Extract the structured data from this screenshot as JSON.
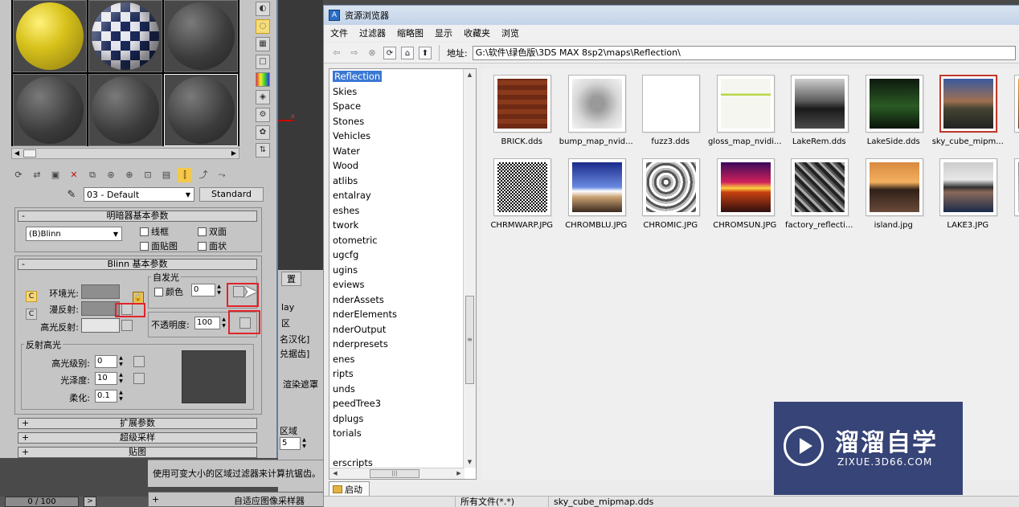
{
  "material_editor": {
    "material_name": "03 - Default",
    "material_type_button": "Standard",
    "shader_rollout": {
      "title": "明暗器基本参数",
      "shader": "(B)Blinn",
      "options": [
        "线框",
        "双面",
        "面贴图",
        "面状"
      ]
    },
    "blinn_rollout": {
      "title": "Blinn 基本参数",
      "ambient_label": "环境光:",
      "diffuse_label": "漫反射:",
      "specular_label": "高光反射:",
      "self_illum_group": "自发光",
      "color_checkbox": "颜色",
      "self_illum_value": "0",
      "opacity_label": "不透明度:",
      "opacity_value": "100",
      "specular_group": "反射高光",
      "specular_level_label": "高光级别:",
      "specular_level_value": "0",
      "glossiness_label": "光泽度:",
      "glossiness_value": "10",
      "soften_label": "柔化:",
      "soften_value": "0.1"
    },
    "collapsed_rollouts": [
      "扩展参数",
      "超级采样",
      "贴图"
    ]
  },
  "render_panel": {
    "tab_fragment": "置",
    "lines": [
      "lay",
      "区",
      "名汉化]",
      "兑据齿]",
      "渲染遮罩",
      "区域"
    ],
    "filter_value": "5",
    "status_text": "使用可变大小的区域过滤器来计算抗锯齿。",
    "bottom_rollout": "自适应图像采样器",
    "time_slider": "0 / 100",
    "time_next": ">"
  },
  "asset_browser": {
    "title": "资源浏览器",
    "menu": [
      "文件",
      "过滤器",
      "缩略图",
      "显示",
      "收藏夹",
      "浏览"
    ],
    "address_label": "地址:",
    "address_value": "G:\\软件\\绿色版\\3DS MAX 8sp2\\maps\\Reflection\\",
    "tree_items": [
      "Reflection",
      "Skies",
      "Space",
      "Stones",
      "Vehicles",
      "Water",
      "Wood",
      "atlibs",
      "entalray",
      "eshes",
      "twork",
      "otometric",
      "ugcfg",
      "ugins",
      "eviews",
      "nderAssets",
      "nderElements",
      "nderOutput",
      "nderpresets",
      "enes",
      "ripts",
      "unds",
      "peedTree3",
      "dplugs",
      "torials",
      "",
      "erscripts"
    ],
    "selected_tree_item": "Reflection",
    "thumbnails": [
      {
        "name": "BRICK.dds",
        "kind": "brick"
      },
      {
        "name": "bump_map_nvid...",
        "kind": "nvidia-gray"
      },
      {
        "name": "fuzz3.dds",
        "kind": "file-icon"
      },
      {
        "name": "gloss_map_nvidi...",
        "kind": "nvidia-green"
      },
      {
        "name": "LakeRem.dds",
        "kind": "lake-dark"
      },
      {
        "name": "LakeSide.dds",
        "kind": "lake-green"
      },
      {
        "name": "sky_cube_mipm...",
        "kind": "sky-cube",
        "selected": true
      },
      {
        "name": "sunc",
        "kind": "sun-partial"
      },
      {
        "name": "CHRMWARP.JPG",
        "kind": "noise"
      },
      {
        "name": "CHROMBLU.JPG",
        "kind": "chrome-blue"
      },
      {
        "name": "CHROMIC.JPG",
        "kind": "chromic"
      },
      {
        "name": "CHROMSUN.JPG",
        "kind": "chrome-sun"
      },
      {
        "name": "factory_reflecti...",
        "kind": "factory"
      },
      {
        "name": "island.jpg",
        "kind": "island"
      },
      {
        "name": "LAKE3.JPG",
        "kind": "lake3"
      },
      {
        "name": "LA",
        "kind": "partial"
      }
    ],
    "tab_label": "启动",
    "status_filter": "所有文件(*.*)",
    "status_file": "sky_cube_mipmap.dds"
  },
  "watermark": {
    "brand": "溜溜自学",
    "url": "ZIXUE.3D66.COM"
  }
}
